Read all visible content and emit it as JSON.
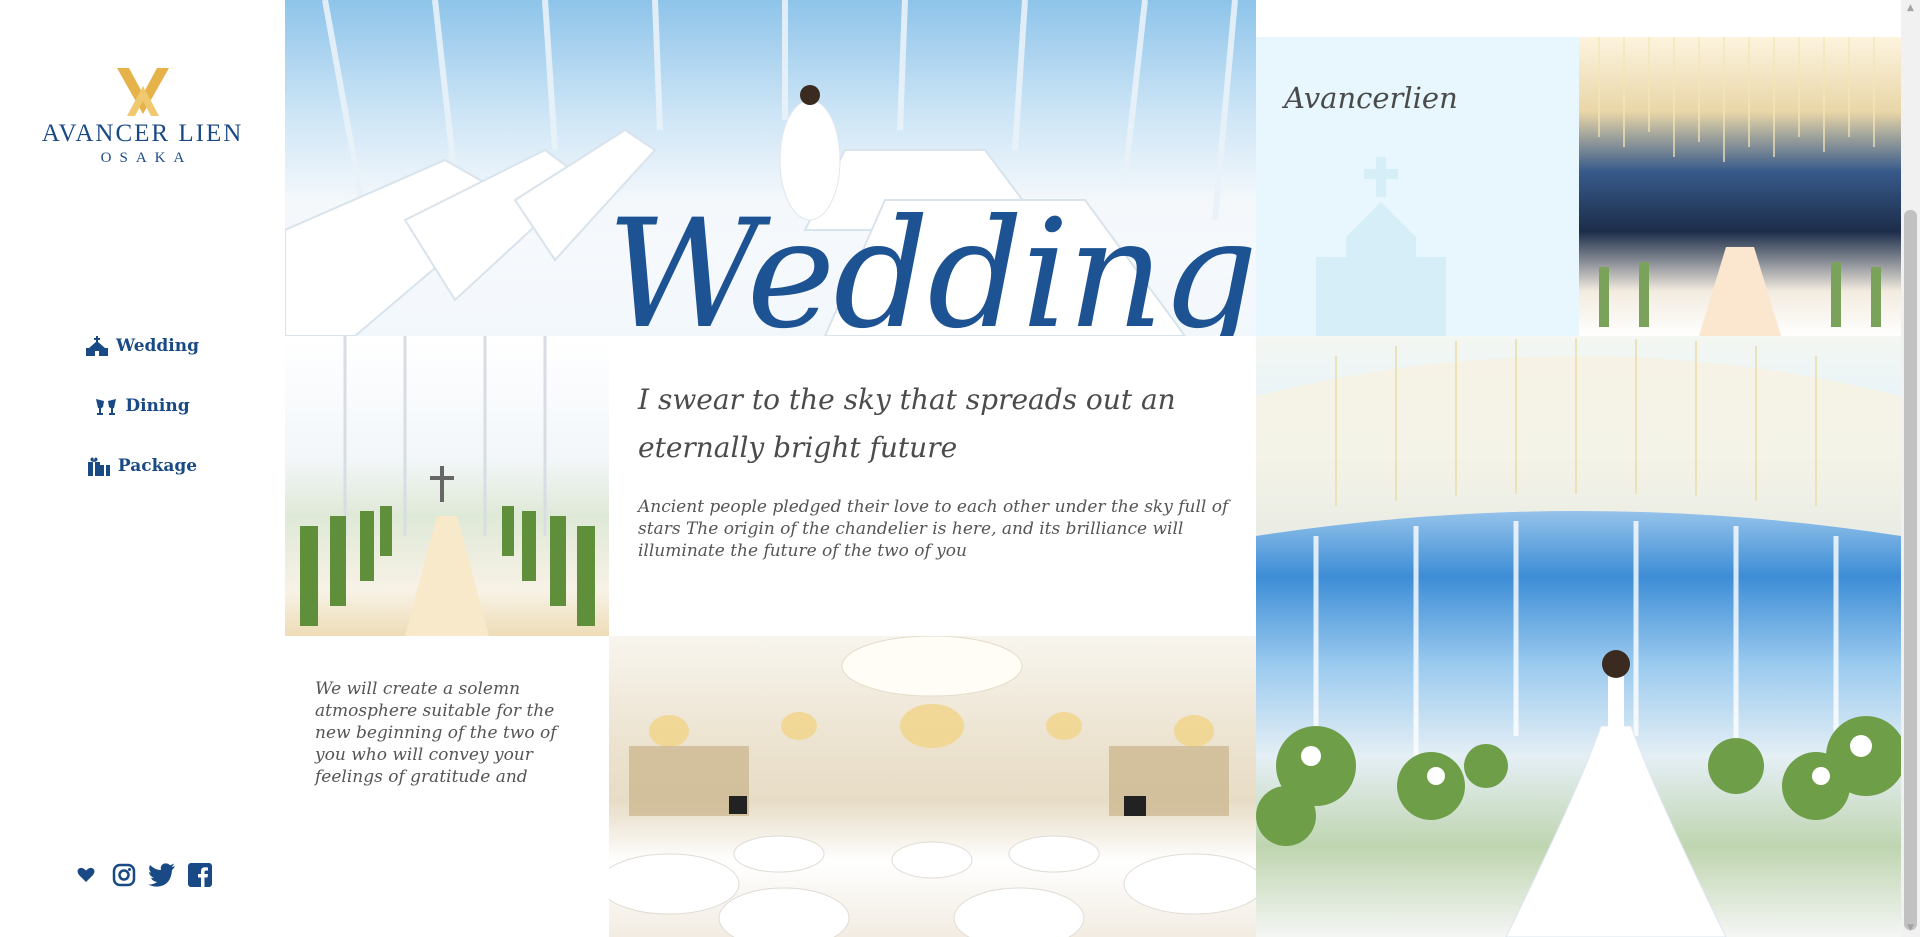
{
  "brand": {
    "name": "AVANCER LIEN",
    "city": "OSAKA",
    "logo_icon": "double-chevron-logo-icon",
    "color": "#1a4a86",
    "accent": "#e6b24a"
  },
  "nav": [
    {
      "label": "Wedding",
      "icon": "chapel-icon"
    },
    {
      "label": "Dining",
      "icon": "toast-glasses-icon"
    },
    {
      "label": "Package",
      "icon": "gifts-icon"
    }
  ],
  "social": [
    {
      "icon": "heart-icon"
    },
    {
      "icon": "instagram-icon"
    },
    {
      "icon": "twitter-icon"
    },
    {
      "icon": "facebook-icon"
    }
  ],
  "hero": {
    "title": "Wedding"
  },
  "intro": {
    "title": "Avancerlien"
  },
  "content": {
    "headline": "I swear to the sky that spreads out an eternally bright future",
    "body": "Ancient people pledged their love to each other under the sky full of stars The origin of the chandelier is here, and its brilliance will illuminate the future of the two of you",
    "side_copy": "We will create a solemn atmosphere suitable for the new beginning of the two of you who will convey your feelings of gratitude and"
  }
}
